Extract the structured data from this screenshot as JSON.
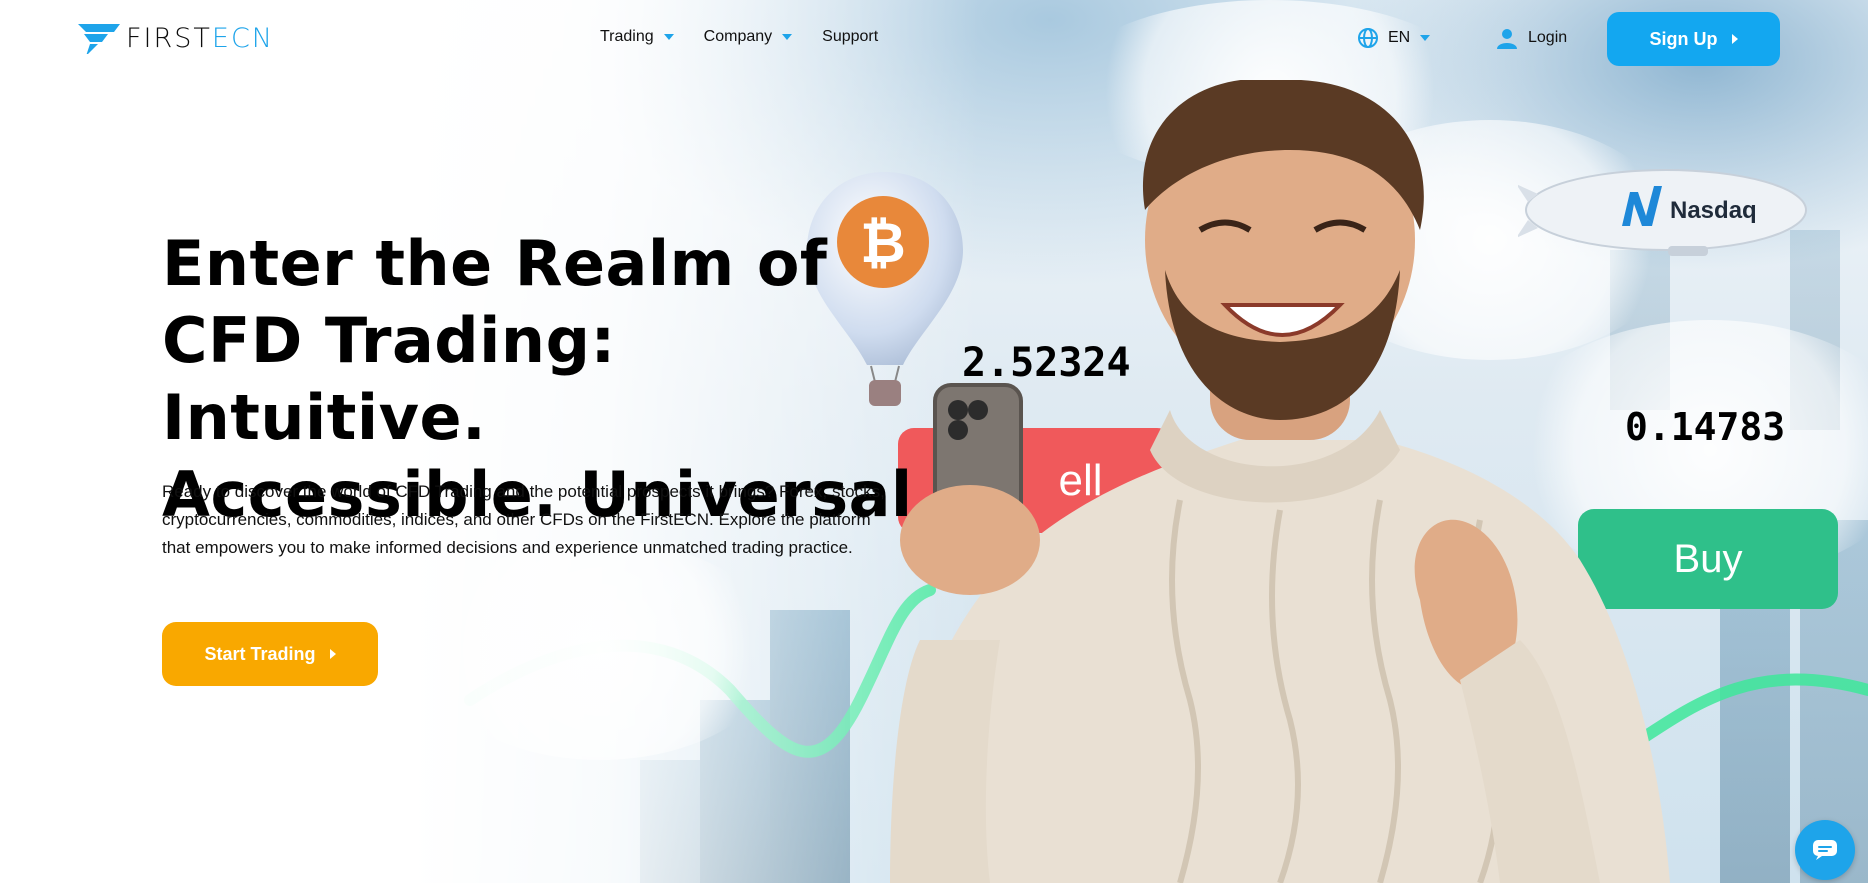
{
  "brand": {
    "name_part1": "FIRST",
    "name_part2": "ECN",
    "accent_color": "#1ea4ea"
  },
  "nav": {
    "items": [
      {
        "label": "Trading",
        "has_dropdown": true
      },
      {
        "label": "Company",
        "has_dropdown": true
      },
      {
        "label": "Support",
        "has_dropdown": false
      }
    ]
  },
  "header": {
    "language": "EN",
    "language_icon": "globe-icon",
    "login_label": "Login",
    "login_icon": "user-icon",
    "signup_label": "Sign Up",
    "signup_color": "#13a7f0"
  },
  "hero": {
    "title_line1": "Enter the Realm of",
    "title_line2": "CFD Trading: Intuitive.",
    "title_line3": "Accessible. Universal",
    "description_line1": "Ready to discover the world of CFD Trading and the potential prospects it brings? Forex, stocks,",
    "description_line2": "cryptocurrencies, commodities, indices, and other CFDs on the FirstECN. Explore the platform",
    "description_line3": "that empowers you to make informed decisions and experience unmatched trading practice.",
    "cta_label": "Start Trading",
    "cta_color": "#f9a800"
  },
  "scene": {
    "ticker_left": "2.52324",
    "ticker_right": "0.14783",
    "sell_label": "ell",
    "buy_label": "Buy",
    "blimp_label": "Nasdaq",
    "balloon_icon": "bitcoin-icon"
  },
  "chat": {
    "icon": "chat-icon"
  }
}
